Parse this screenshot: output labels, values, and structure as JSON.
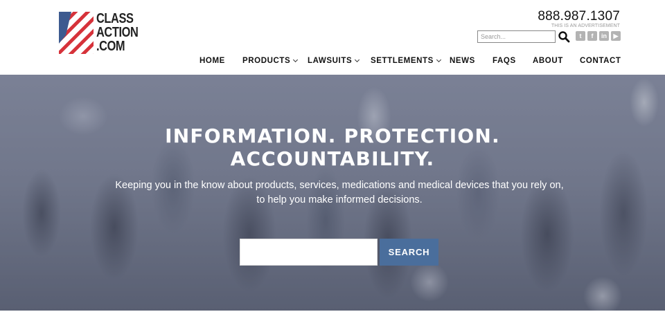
{
  "header": {
    "logo_text": [
      "CLASS",
      "ACTION",
      ".COM"
    ],
    "phone": "888.987.1307",
    "ad_note": "THIS IS AN ADVERTISEMENT",
    "search_placeholder": "Search..."
  },
  "nav": {
    "items": [
      {
        "label": "HOME",
        "has_dropdown": false
      },
      {
        "label": "PRODUCTS",
        "has_dropdown": true
      },
      {
        "label": "LAWSUITS",
        "has_dropdown": true
      },
      {
        "label": "SETTLEMENTS",
        "has_dropdown": true
      },
      {
        "label": "NEWS",
        "has_dropdown": false
      },
      {
        "label": "FAQS",
        "has_dropdown": false
      },
      {
        "label": "ABOUT",
        "has_dropdown": false
      },
      {
        "label": "CONTACT",
        "has_dropdown": false
      }
    ]
  },
  "social": {
    "icons": [
      "twitter-icon",
      "facebook-icon",
      "linkedin-icon",
      "youtube-icon"
    ]
  },
  "hero": {
    "title_line1": "INFORMATION. PROTECTION.",
    "title_line2": "ACCOUNTABILITY.",
    "subtitle_line1": "Keeping you in the know about products, services, medications and medical devices that you rely on,",
    "subtitle_line2": "to help you make informed decisions.",
    "search_value": "",
    "search_button": "SEARCH"
  },
  "colors": {
    "accent": "#4a6e9c",
    "flag_red": "#d6323a",
    "flag_blue": "#3d5a8f"
  }
}
